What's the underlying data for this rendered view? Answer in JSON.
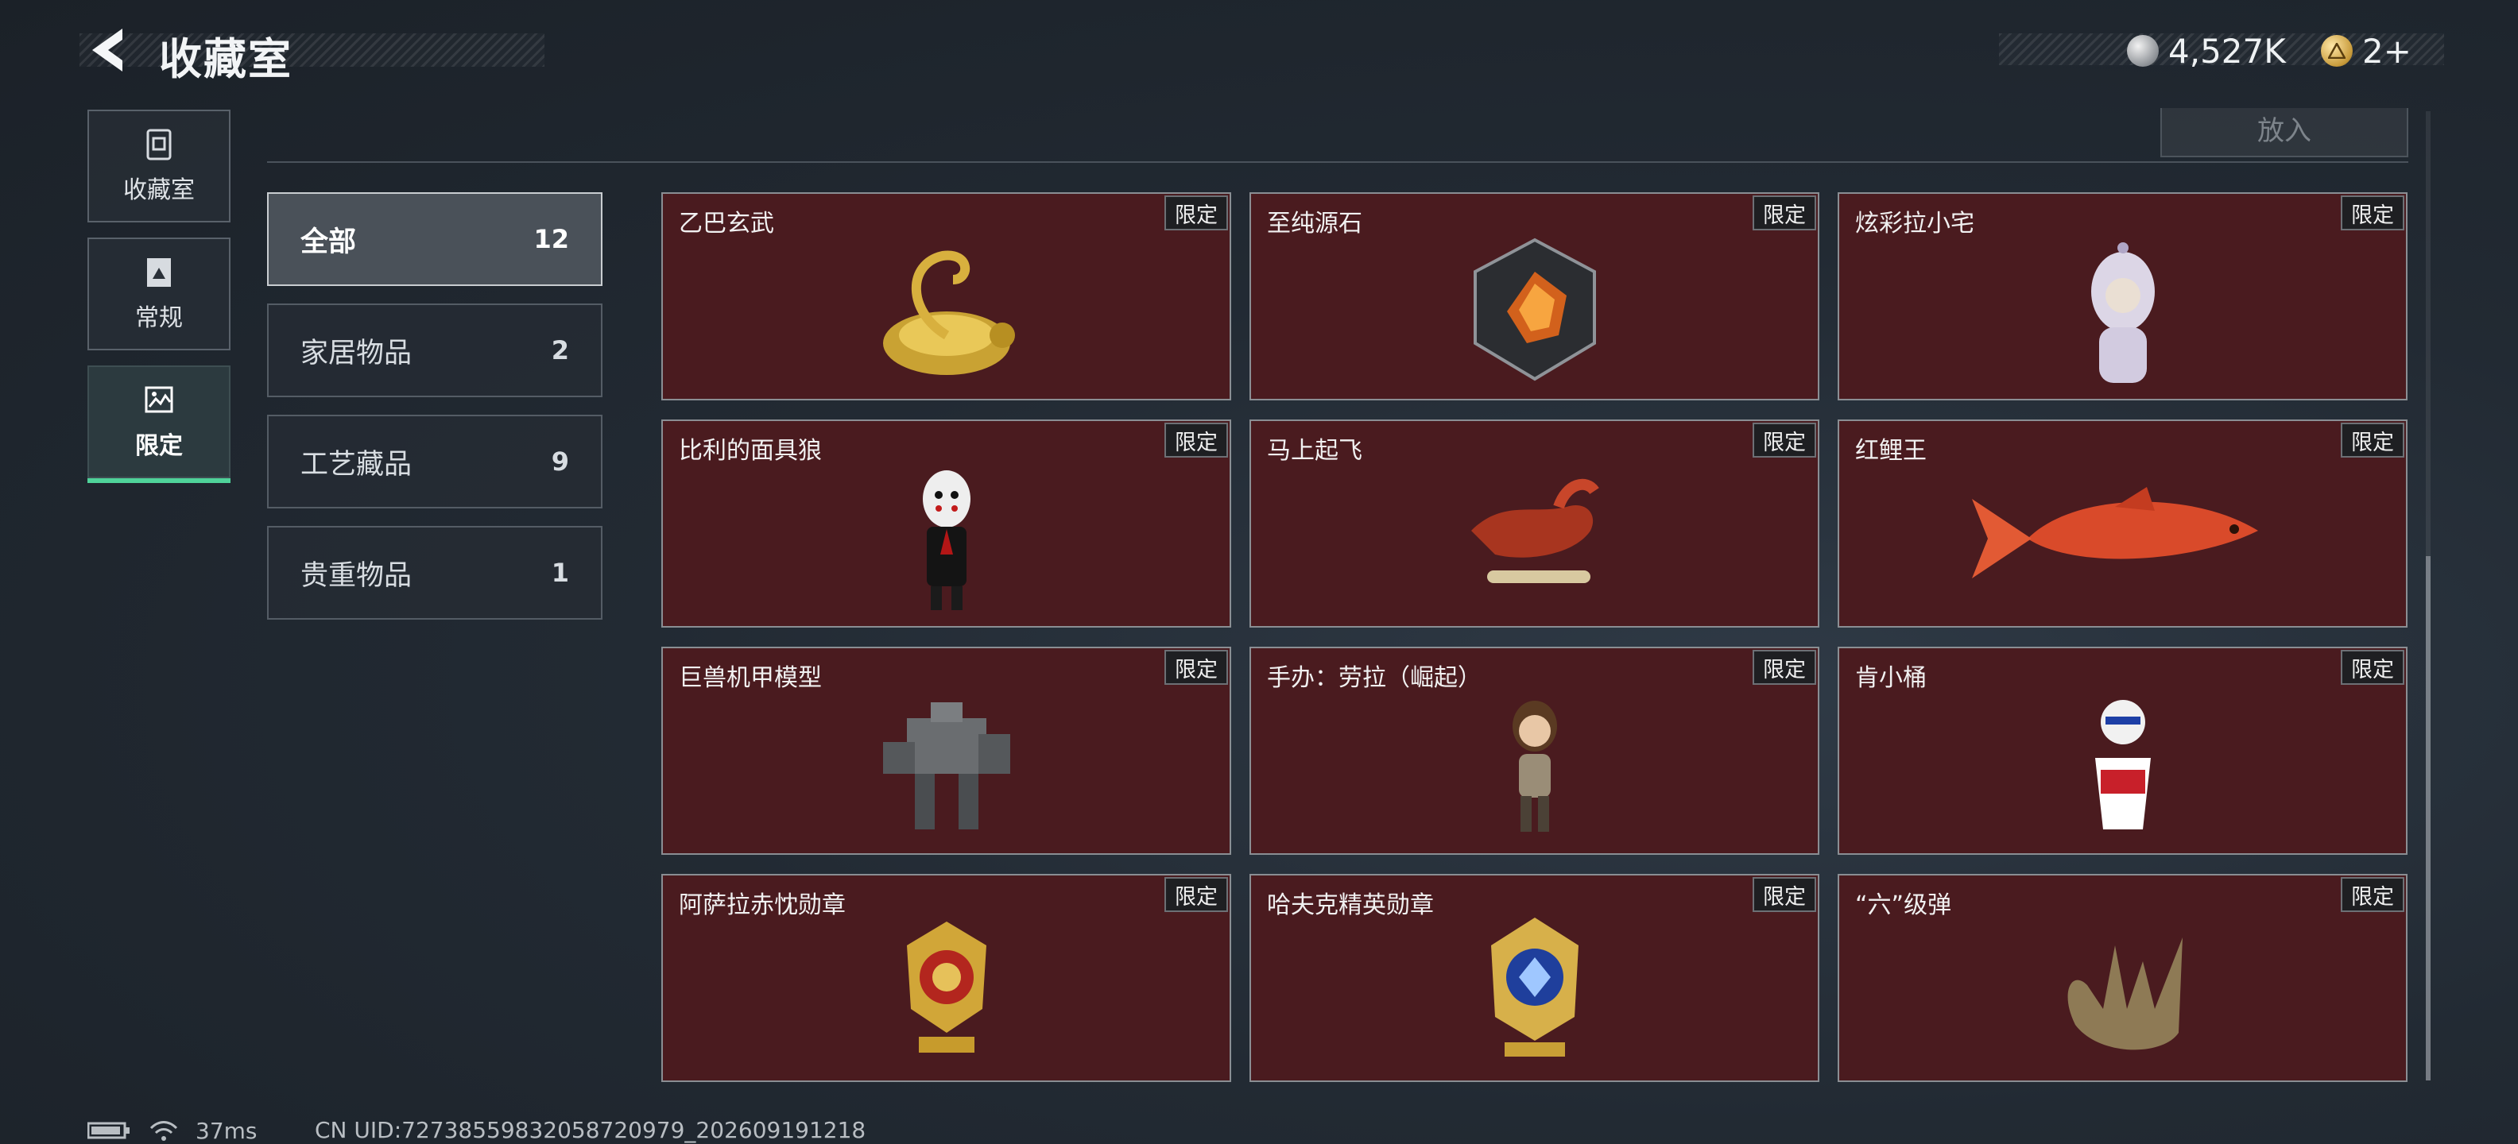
{
  "header": {
    "title": "收藏室",
    "currencies": [
      {
        "icon": "silver-coin-icon",
        "value": "4,527K"
      },
      {
        "icon": "gold-token-icon",
        "value": "2+"
      }
    ]
  },
  "nav": [
    {
      "label": "收藏室",
      "icon": "collection-room-icon"
    },
    {
      "label": "常规",
      "icon": "regular-icon"
    },
    {
      "label": "限定",
      "icon": "limited-icon",
      "active": true
    }
  ],
  "categories": [
    {
      "label": "全部",
      "count": "12",
      "active": true
    },
    {
      "label": "家居物品",
      "count": "2"
    },
    {
      "label": "工艺藏品",
      "count": "9"
    },
    {
      "label": "贵重物品",
      "count": "1"
    }
  ],
  "place_button": "放入",
  "tag_label": "限定",
  "items": [
    {
      "name": "乙巴玄武",
      "icon": "golden-turtle-snake-figure-icon"
    },
    {
      "name": "至纯源石",
      "icon": "pure-origin-stone-icon"
    },
    {
      "name": "炫彩拉小宅",
      "icon": "hooded-doll-figure-icon"
    },
    {
      "name": "比利的面具狼",
      "icon": "billy-puppet-figure-icon"
    },
    {
      "name": "马上起飞",
      "icon": "red-horse-figure-icon"
    },
    {
      "name": "红鲤王",
      "icon": "red-carp-icon"
    },
    {
      "name": "巨兽机甲模型",
      "icon": "mech-model-icon"
    },
    {
      "name": "手办：劳拉（崛起）",
      "icon": "lara-figure-icon"
    },
    {
      "name": "肯小桶",
      "icon": "colonel-bucket-figure-icon"
    },
    {
      "name": "阿萨拉赤忱勋章",
      "icon": "asala-medal-icon"
    },
    {
      "name": "哈夫克精英勋章",
      "icon": "haavk-elite-medal-icon"
    },
    {
      "name": "“六”级弹",
      "icon": "hand-sign-bullets-icon"
    }
  ],
  "status": {
    "ping": "37ms",
    "uid": "CN UID:72738559832058720979_202609191218"
  },
  "colors": {
    "card_bg": "#4a1b1f",
    "accent_green": "#4fd39a"
  }
}
